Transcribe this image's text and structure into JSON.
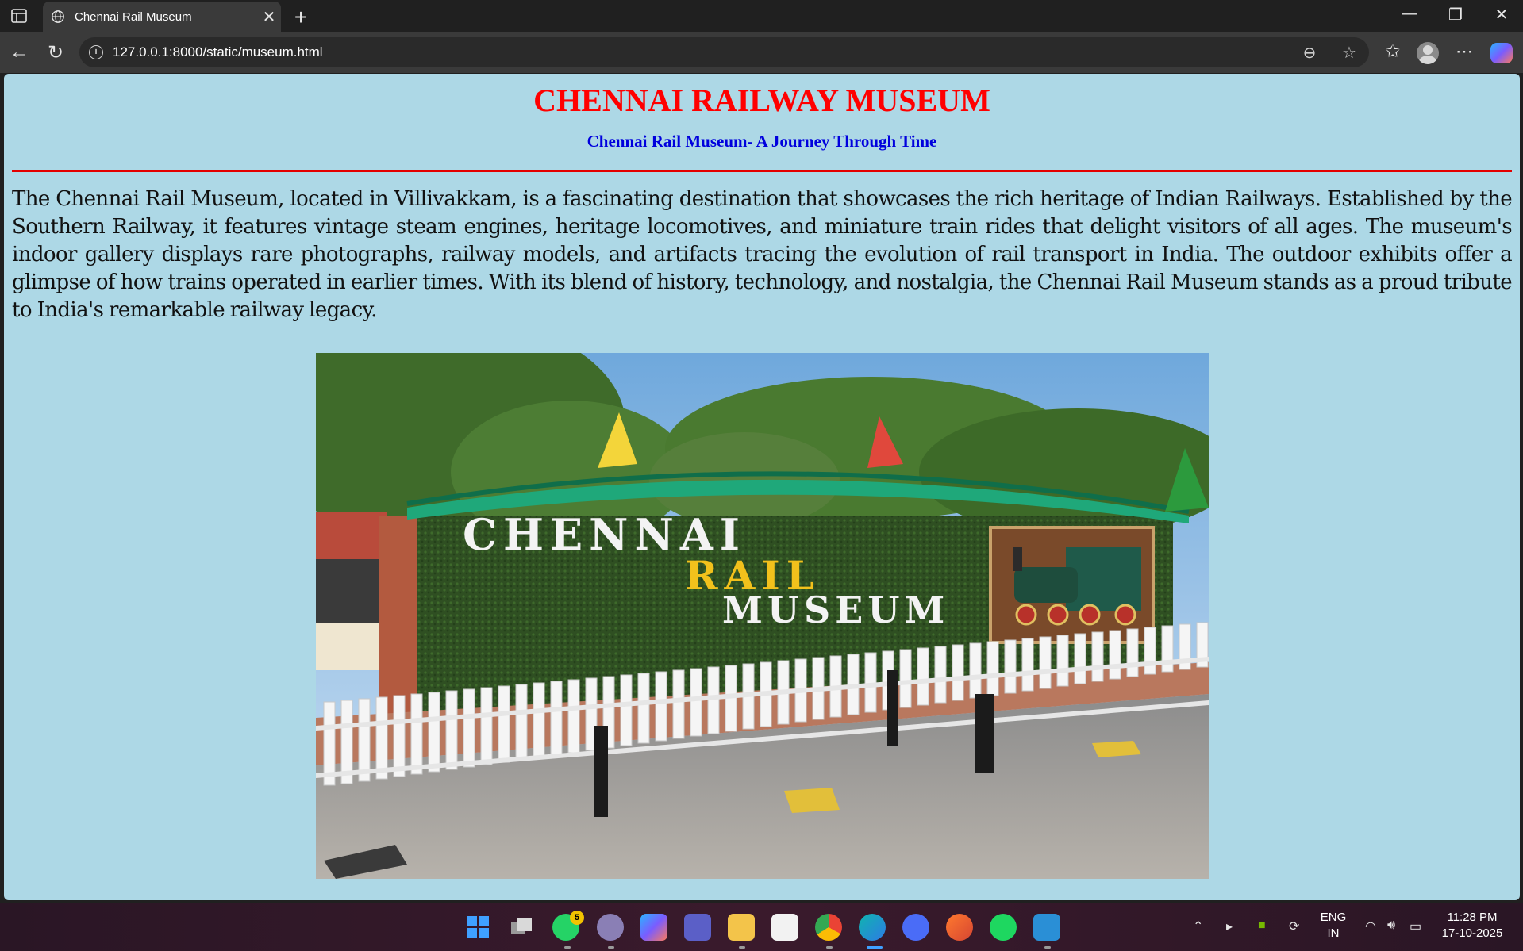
{
  "browser": {
    "tab_title": "Chennai Rail Museum",
    "url": "127.0.0.1:8000/static/museum.html"
  },
  "page": {
    "heading": "CHENNAI RAILWAY MUSEUM",
    "subheading": "Chennai Rail Museum- A Journey Through Time",
    "description": "The Chennai Rail Museum, located in Villivakkam, is a fascinating destination that showcases the rich heritage of Indian Railways. Established by the Southern Railway, it features vintage steam engines, heritage locomotives, and miniature train rides that delight visitors of all ages. The museum's indoor gallery displays rare photographs, railway models, and artifacts tracing the evolution of rail transport in India. The outdoor exhibits offer a glimpse of how trains operated in earlier times. With its blend of history, technology, and nostalgia, the Chennai Rail Museum stands as a proud tribute to India's remarkable railway legacy.",
    "photo_sign": {
      "line1": "CHENNAI",
      "line2": "RAIL",
      "line3": "MUSEUM"
    }
  },
  "taskbar": {
    "whatsapp_badge": "5",
    "lang_top": "ENG",
    "lang_bottom": "IN",
    "time": "11:28 PM",
    "date": "17-10-2025"
  },
  "colors": {
    "page_bg": "#add8e6",
    "heading": "#ff0000",
    "subheading": "#0000dd",
    "rule": "#e30000"
  }
}
